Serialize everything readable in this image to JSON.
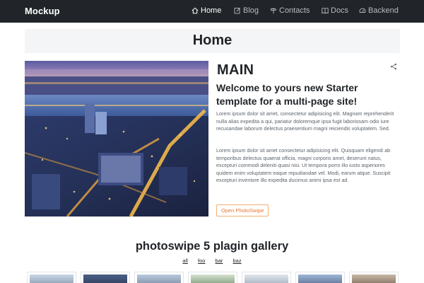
{
  "navbar": {
    "brand": "Mockup",
    "items": [
      {
        "label": "Home",
        "icon": "home-icon",
        "active": true
      },
      {
        "label": "Blog",
        "icon": "edit-icon",
        "active": false
      },
      {
        "label": "Contacts",
        "icon": "signpost-icon",
        "active": false
      },
      {
        "label": "Docs",
        "icon": "book-icon",
        "active": false
      },
      {
        "label": "Backend",
        "icon": "speedometer-icon",
        "active": false
      }
    ]
  },
  "page": {
    "title": "Home"
  },
  "main": {
    "heading": "MAIN",
    "subheading": "Welcome to yours new Starter template for a multi-page site!",
    "paragraph1": "Lorem ipsum dolor sit amet, consectetur adipisicing elit. Magnam reprehenderit nulla alias expedita a qui, pariatur doloremque ipsa fugit laboriosam odio iure recusandae laborum delectus praesentium magni reiciendis voluptatem. Sed.",
    "paragraph2": "Lorem ipsum dolor sit amet consectetur adipisicing elit. Quisquam eligendi ab temporibus delectus quaerat officia, magni corporis amet, deserunt natus, excepturi commodi deleniti quasi nisi. Ut tempora porro illo iusto asperiores quidem enim voluptatem eaque repudiandae vel. Modi, earum atque. Suscipit excepturi inventore illo expedita ducimus animi ipsa est ad.",
    "button_label": "Open PhotoSwipe"
  },
  "gallery": {
    "title": "photoswipe 5 plagin gallery",
    "filters": [
      "all",
      "foo",
      "bar",
      "baz"
    ],
    "thumb_count": 7
  },
  "colors": {
    "navbar_bg": "#212529",
    "accent": "#e8772e",
    "title_bar_bg": "#f4f5f6"
  }
}
